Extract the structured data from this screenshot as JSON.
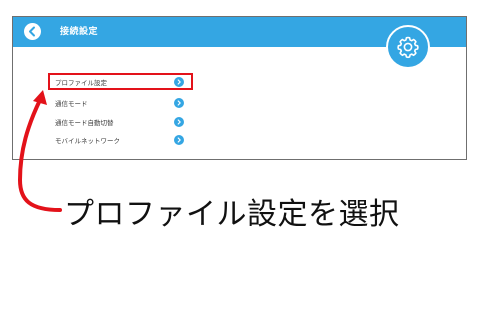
{
  "header": {
    "title": "接続設定",
    "back_icon": "back-arrow-icon",
    "settings_icon": "gear-icon"
  },
  "menu": {
    "items": [
      {
        "label": "プロファイル設定",
        "highlighted": true
      },
      {
        "label": "通信モード"
      },
      {
        "label": "通信モード自動切替"
      },
      {
        "label": "モバイルネットワーク"
      }
    ],
    "arrow_icon": "chevron-right-icon"
  },
  "annotation": {
    "instruction": "プロファイル設定を選択"
  },
  "colors": {
    "header_bg": "#34a6e3",
    "highlight": "#e3121a",
    "arrow": "#e3121a"
  }
}
